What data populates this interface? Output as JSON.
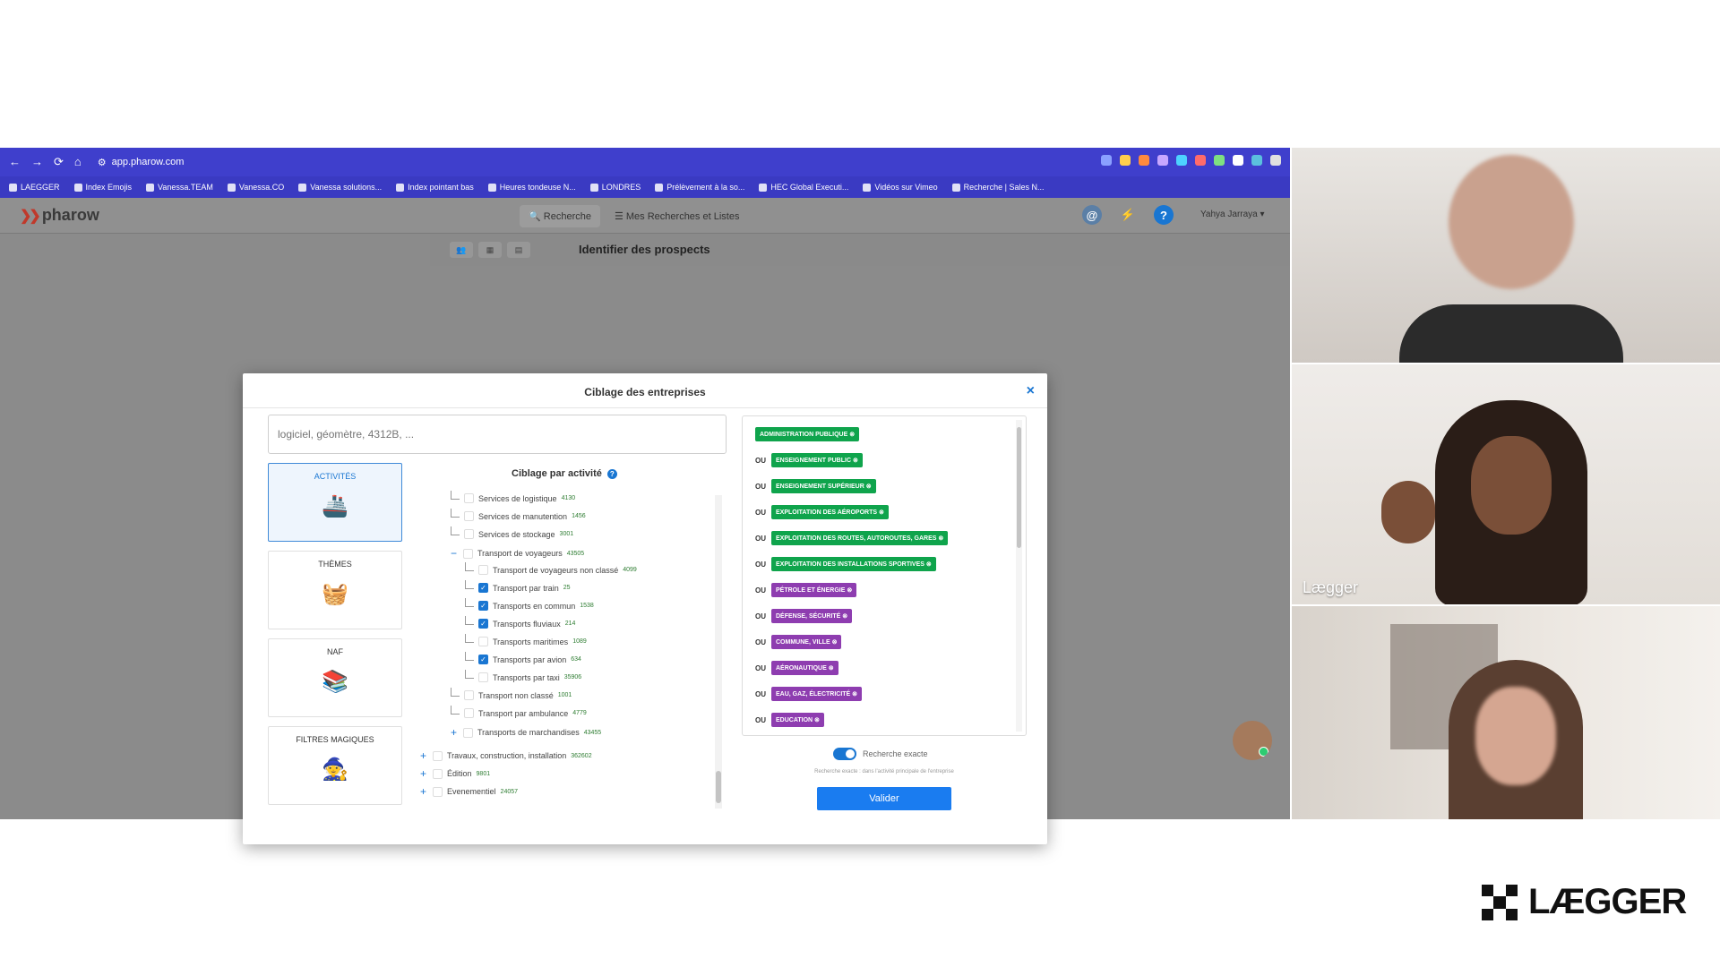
{
  "browser": {
    "url": "app.pharow.com",
    "bookmarks": [
      "LAEGGER",
      "Index Emojis",
      "Vanessa.TEAM",
      "Vanessa.CO",
      "Vanessa solutions...",
      "Index pointant bas",
      "Heures tondeuse N...",
      "LONDRES",
      "Prélèvement à la so...",
      "HEC Global Executi...",
      "Vidéos sur Vimeo",
      "Recherche | Sales N..."
    ]
  },
  "app": {
    "logo": "pharow",
    "nav": {
      "search": "Recherche",
      "lists": "Mes Recherches et Listes"
    },
    "user": "Yahya Jarraya",
    "page_title": "Identifier des prospects"
  },
  "modal": {
    "title": "Ciblage des entreprises",
    "close": "×",
    "search_placeholder": "logiciel, géomètre, 4312B, ...",
    "categories": [
      "ACTIVITÉS",
      "THÈMES",
      "NAF",
      "FILTRES MAGIQUES"
    ],
    "tree_title": "Ciblage par activité",
    "tree": [
      {
        "label": "Services de logistique",
        "count": "4130",
        "level": 1,
        "checked": false
      },
      {
        "label": "Services de manutention",
        "count": "1456",
        "level": 1,
        "checked": false
      },
      {
        "label": "Services de stockage",
        "count": "3001",
        "level": 1,
        "checked": false
      },
      {
        "label": "Transport de voyageurs",
        "count": "43505",
        "level": 1,
        "checked": false,
        "expanded": true
      },
      {
        "label": "Transport de voyageurs non classé",
        "count": "4099",
        "level": 2,
        "checked": false
      },
      {
        "label": "Transport par train",
        "count": "25",
        "level": 2,
        "checked": true
      },
      {
        "label": "Transports en commun",
        "count": "1538",
        "level": 2,
        "checked": true
      },
      {
        "label": "Transports fluviaux",
        "count": "214",
        "level": 2,
        "checked": true
      },
      {
        "label": "Transports maritimes",
        "count": "1089",
        "level": 2,
        "checked": false
      },
      {
        "label": "Transports par avion",
        "count": "634",
        "level": 2,
        "checked": true
      },
      {
        "label": "Transports par taxi",
        "count": "35906",
        "level": 2,
        "checked": false
      },
      {
        "label": "Transport non classé",
        "count": "1001",
        "level": 1,
        "checked": false
      },
      {
        "label": "Transport par ambulance",
        "count": "4779",
        "level": 1,
        "checked": false
      },
      {
        "label": "Transports de marchandises",
        "count": "43455",
        "level": 1,
        "checked": false,
        "collapsed": true
      },
      {
        "label": "Travaux, construction, installation",
        "count": "362602",
        "level": 0,
        "checked": false,
        "collapsed": true
      },
      {
        "label": "Édition",
        "count": "9801",
        "level": 0,
        "checked": false,
        "collapsed": true
      },
      {
        "label": "Evenementiel",
        "count": "24057",
        "level": 0,
        "checked": false,
        "collapsed": true
      }
    ],
    "selected": [
      {
        "prefix": "",
        "label": "ADMINISTRATION PUBLIQUE",
        "color": "#0fa44c"
      },
      {
        "prefix": "OU",
        "label": "ENSEIGNEMENT PUBLIC",
        "color": "#0fa44c"
      },
      {
        "prefix": "OU",
        "label": "ENSEIGNEMENT SUPÉRIEUR",
        "color": "#0fa44c"
      },
      {
        "prefix": "OU",
        "label": "EXPLOITATION DES AÉROPORTS",
        "color": "#0fa44c"
      },
      {
        "prefix": "OU",
        "label": "EXPLOITATION DES ROUTES, AUTOROUTES, GARES",
        "color": "#0fa44c"
      },
      {
        "prefix": "OU",
        "label": "EXPLOITATION DES INSTALLATIONS SPORTIVES",
        "color": "#0fa44c"
      },
      {
        "prefix": "OU",
        "label": "PÉTROLE ET ÉNERGIE",
        "color": "#8e3db0"
      },
      {
        "prefix": "OU",
        "label": "DÉFENSE, SÉCURITÉ",
        "color": "#8e3db0"
      },
      {
        "prefix": "OU",
        "label": "COMMUNE, VILLE",
        "color": "#8e3db0"
      },
      {
        "prefix": "OU",
        "label": "AÉRONAUTIQUE",
        "color": "#8e3db0"
      },
      {
        "prefix": "OU",
        "label": "EAU, GAZ, ÉLECTRICITÉ",
        "color": "#8e3db0"
      },
      {
        "prefix": "OU",
        "label": "EDUCATION",
        "color": "#8e3db0"
      }
    ],
    "exact_search_label": "Recherche exacte",
    "exact_search_on": true,
    "exact_search_hint": "Recherche exacte : dans l'activité principale de l'entreprise",
    "validate": "Valider"
  },
  "participants": [
    {
      "name": ""
    },
    {
      "name": "Lægger"
    },
    {
      "name": ""
    }
  ],
  "brand": "LÆGGER"
}
